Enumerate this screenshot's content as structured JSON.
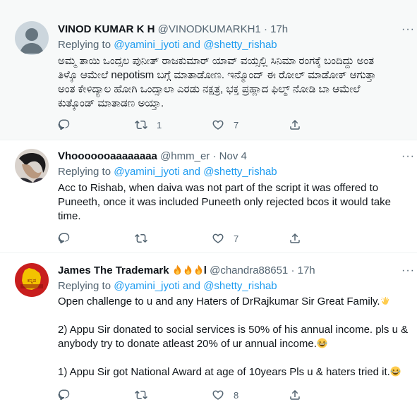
{
  "tweets": [
    {
      "name": "VINOD KUMAR K H",
      "handle": "@VINODKUMARKH1",
      "dot": "·",
      "time": "17h",
      "reply_prefix": "Replying to ",
      "mention1": "@yamini_jyoti",
      "and": " and ",
      "mention2": "@shetty_rishab",
      "text": "ಅಮ್ಮ ತಾಯಿ ಒಂದ್ಸಲ ಪುನೀತ್ ರಾಜಕುಮಾರ್ ಯಾವ್ ವಯ್ಸಲ್ಲಿ ಸಿನಿಮಾ ರಂಗಕ್ಕೆ ಬಂದಿದ್ದು ಅಂತ\nತಿಳ್ಕೊ ಆಮೇಲೆ nepotism ಬಗ್ಗೆ ಮಾತಾಡೋಣ. ಇನ್ಮೊಂದ್ ಈ ರೋಲ್ ಮಾಡೋಕ್ ಆಗುತ್ತಾ\nಅಂತ ಕೇಳಿದ್ಯಾಲ ಹೋಗಿ ಒಂದ್ಸಾಲಾ ಎರಡು ನಕ್ಷತ್ರ, ಭಕ್ತ ಪ್ರಹ್ಲಾದ ಫಿಲ್ಮ್ ನೋಡಿ ಬಾ ಆಮೇಲೆ\nಕುತ್ಕೊಂಡ್ ಮಾತಾಡಣ ಅಯ್ತಾ.",
      "replies": "",
      "retweets": "1",
      "likes": "7"
    },
    {
      "name": "Vhooooooaaaaaaaa",
      "handle": "@hmm_er",
      "dot": "·",
      "time": "Nov 4",
      "reply_prefix": "Replying to ",
      "mention1": "@yamini_jyoti",
      "and": " and ",
      "mention2": "@shetty_rishab",
      "text": "Acc to Rishab, when daiva was not part of the script it was offered to\nPuneeth, once it was included Puneeth only rejected bcos it would take\ntime.",
      "replies": "",
      "retweets": "",
      "likes": "7"
    },
    {
      "name": "James The Trademark",
      "name_suffix": "l",
      "handle": "@chandra88651",
      "dot": "·",
      "time": "17h",
      "reply_prefix": "Replying to ",
      "mention1": "@yamini_jyoti",
      "and": " and ",
      "mention2": "@shetty_rishab",
      "line1": "Open challenge to u and any Haters of DrRajkumar Sir Great Family.",
      "line2": "2) Appu Sir donated to social services is 50% of his annual income. pls u &",
      "line3": "anybody try to donate atleast 20% of ur annual income.",
      "line4": "1) Appu Sir got National Award at age of 10years Pls u & haters tried it.",
      "replies": "",
      "retweets": "",
      "likes": "8"
    }
  ],
  "icons": {
    "more": "more-icon",
    "reply": "reply-icon",
    "retweet": "retweet-icon",
    "like": "like-icon",
    "share": "share-icon",
    "fire": "fire-emoji",
    "wave": "waving-hand-emoji",
    "laugh": "laughing-emoji"
  },
  "colors": {
    "link": "#1d9bf0",
    "secondary": "#536471",
    "highlight_bg": "#f7f9f9",
    "divider": "#eff3f4"
  }
}
